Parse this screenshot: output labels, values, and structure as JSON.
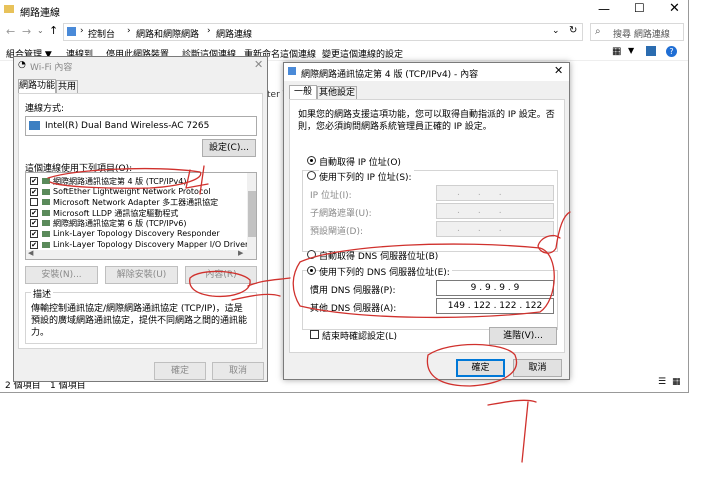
{
  "explorer": {
    "title": "網路連線",
    "breadcrumb": [
      "控制台",
      "網路和網際網路",
      "網路連線"
    ],
    "search_placeholder": "搜尋 網路連線",
    "toolbar": [
      "組合管理 ▼",
      "連線到",
      "停用此網路裝置",
      "診斷這個連線",
      "重新命名這個連線",
      "變更這個連線的設定"
    ],
    "status_items": "2 個項目",
    "status_selected": "1 個項目",
    "partial_text": "ter V"
  },
  "wifi_props": {
    "title": "Wi-Fi 內容",
    "tabs": [
      "網路功能",
      "共用"
    ],
    "connect_using_label": "連線方式:",
    "adapter": "Intel(R) Dual Band Wireless-AC 7265",
    "configure_btn": "設定(C)...",
    "items_label": "這個連線使用下列項目(O):",
    "items": [
      {
        "label": "網際網路通訊協定第 4 版 (TCP/IPv4)",
        "checked": true
      },
      {
        "label": "SoftEther Lightweight Network Protocol",
        "checked": true
      },
      {
        "label": "Microsoft Network Adapter 多工器通訊協定",
        "checked": false
      },
      {
        "label": "Microsoft LLDP 通訊協定驅動程式",
        "checked": true
      },
      {
        "label": "網際網路通訊協定第 6 版 (TCP/IPv6)",
        "checked": true
      },
      {
        "label": "Link-Layer Topology Discovery Responder",
        "checked": true
      },
      {
        "label": "Link-Layer Topology Discovery Mapper I/O Driver",
        "checked": true
      }
    ],
    "install_btn": "安裝(N)...",
    "uninstall_btn": "解除安裝(U)",
    "properties_btn": "內容(R)",
    "description_group": "描述",
    "description": "傳輸控制通訊協定/網際網路通訊協定 (TCP/IP)，這是預設的廣域網路通訊協定，提供不同網路之間的通訊能力。",
    "ok_btn": "確定",
    "cancel_btn": "取消"
  },
  "ipv4_props": {
    "title": "網際網路通訊協定第 4 版 (TCP/IPv4) - 內容",
    "tabs": [
      "一般",
      "其他設定"
    ],
    "intro": "如果您的網路支援這項功能，您可以取得自動指派的 IP 設定。否則，您必須詢問網路系統管理員正確的 IP 設定。",
    "auto_ip": "自動取得 IP 位址(O)",
    "manual_ip": "使用下列的 IP 位址(S):",
    "ip_label": "IP 位址(I):",
    "mask_label": "子網路遮罩(U):",
    "gateway_label": "預設閘道(D):",
    "auto_dns": "自動取得 DNS 伺服器位址(B)",
    "manual_dns": "使用下列的 DNS 伺服器位址(E):",
    "pref_dns_label": "慣用 DNS 伺服器(P):",
    "pref_dns": "9 . 9 . 9 . 9",
    "alt_dns_label": "其他 DNS 伺服器(A):",
    "alt_dns": "149 . 122 . 122 . 122",
    "validate": "結束時確認設定(L)",
    "advanced_btn": "進階(V)...",
    "ok_btn": "確定",
    "cancel_btn": "取消"
  }
}
